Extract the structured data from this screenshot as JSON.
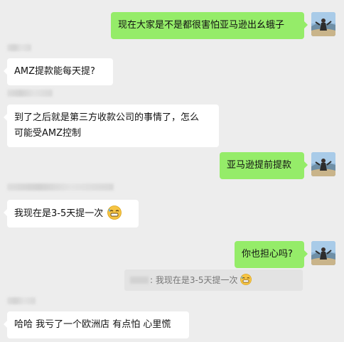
{
  "messages": [
    {
      "side": "out",
      "text": "现在大家是不是都很害怕亚马逊出幺蛾子"
    },
    {
      "side": "in",
      "text": "AMZ提款能每天提?"
    },
    {
      "side": "in",
      "line1": "到了之后就是第三方收款公司的事情了，怎么",
      "line2": "可能受AMZ控制"
    },
    {
      "side": "out",
      "text": "亚马逊提前提款"
    },
    {
      "side": "in",
      "text": "我现在是3-5天提一次",
      "emoji": "grimace-sweat-emoji"
    },
    {
      "side": "out",
      "text": "你也担心吗?"
    },
    {
      "quote": {
        "text": ": 我现在是3-5天提一次",
        "emoji": "grimace-sweat-emoji"
      }
    },
    {
      "side": "in",
      "text": "哈哈 我亏了一个欧洲店 有点怕 心里慌"
    }
  ]
}
